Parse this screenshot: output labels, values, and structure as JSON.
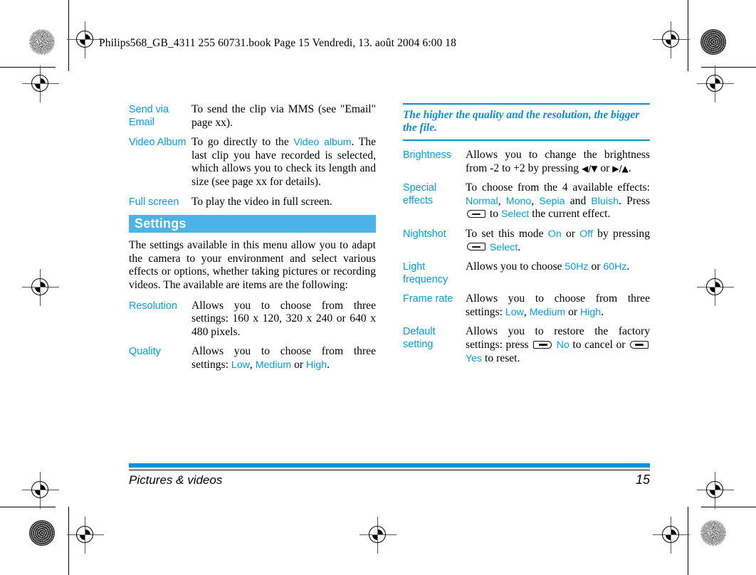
{
  "running_header": "Philips568_GB_4311 255 60731.book  Page 15  Vendredi, 13. août 2004  6:00 18",
  "left_column": {
    "rows_top": [
      {
        "term": "Send via Email",
        "parts": [
          {
            "t": "To send the clip via MMS (see \"Email\" page xx).",
            "blue": false
          }
        ]
      },
      {
        "term": "Video Album",
        "parts": [
          {
            "t": "To go directly to the ",
            "blue": false
          },
          {
            "t": "Video album",
            "blue": true
          },
          {
            "t": ". The last clip you have recorded is selected, which allows you to check its length and size (see page xx for details).",
            "blue": false
          }
        ]
      },
      {
        "term": "Full screen",
        "parts": [
          {
            "t": "To play the video in full screen.",
            "blue": false
          }
        ]
      }
    ],
    "section_title": "Settings",
    "intro_paragraph": "The settings available in this menu allow you to adapt the camera to your environment and select various effects or options, whether taking pictures or recording videos. The available are items are the following:",
    "rows_bottom": [
      {
        "term": "Resolution",
        "parts": [
          {
            "t": "Allows you to choose from three settings:   160 x 120,   320 x 240   or 640 x 480 pixels.",
            "blue": false
          }
        ]
      },
      {
        "term": "Quality",
        "parts": [
          {
            "t": "Allows you to choose from three settings: ",
            "blue": false
          },
          {
            "t": "Low",
            "blue": true
          },
          {
            "t": ", ",
            "blue": false
          },
          {
            "t": "Medium",
            "blue": true
          },
          {
            "t": " or ",
            "blue": false
          },
          {
            "t": "High",
            "blue": true
          },
          {
            "t": ".",
            "blue": false
          }
        ]
      }
    ]
  },
  "right_column": {
    "note": "The higher the quality and the resolution, the bigger the file.",
    "rows": [
      {
        "term": "Brightness",
        "parts": [
          {
            "t": "Allows you to change the brightness from -2 to +2 by pressing ",
            "blue": false
          },
          {
            "t": "◀/▼",
            "blue": false,
            "arrows": true
          },
          {
            "t": " or ",
            "blue": false
          },
          {
            "t": "▶/▲",
            "blue": false,
            "arrows": true
          },
          {
            "t": ".",
            "blue": false
          }
        ]
      },
      {
        "term": "Special effects",
        "parts": [
          {
            "t": "To choose from the 4 available effects: ",
            "blue": false
          },
          {
            "t": "Normal",
            "blue": true
          },
          {
            "t": ", ",
            "blue": false
          },
          {
            "t": "Mono",
            "blue": true
          },
          {
            "t": ", ",
            "blue": false
          },
          {
            "t": "Sepia",
            "blue": true
          },
          {
            "t": " and ",
            "blue": false
          },
          {
            "t": "Bluish",
            "blue": true
          },
          {
            "t": ". Press ",
            "blue": false
          },
          {
            "softkey": "left"
          },
          {
            "t": " to ",
            "blue": false
          },
          {
            "t": "Select",
            "blue": true
          },
          {
            "t": " the current effect.",
            "blue": false
          }
        ]
      },
      {
        "term": "Nightshot",
        "parts": [
          {
            "t": "To set this mode ",
            "blue": false
          },
          {
            "t": "On",
            "blue": true
          },
          {
            "t": " or ",
            "blue": false
          },
          {
            "t": "Off",
            "blue": true
          },
          {
            "t": " by pressing ",
            "blue": false
          },
          {
            "softkey": "left"
          },
          {
            "t": " ",
            "blue": false
          },
          {
            "t": "Select",
            "blue": true
          },
          {
            "t": ".",
            "blue": false
          }
        ]
      },
      {
        "term": "Light frequency",
        "parts": [
          {
            "t": "Allows you to choose ",
            "blue": false
          },
          {
            "t": "50Hz",
            "blue": true
          },
          {
            "t": " or ",
            "blue": false
          },
          {
            "t": "60Hz",
            "blue": true
          },
          {
            "t": ".",
            "blue": false
          }
        ]
      },
      {
        "term": "Frame rate",
        "parts": [
          {
            "t": "Allows you to choose from three settings: ",
            "blue": false
          },
          {
            "t": "Low",
            "blue": true
          },
          {
            "t": ", ",
            "blue": false
          },
          {
            "t": "Medium",
            "blue": true
          },
          {
            "t": " or ",
            "blue": false
          },
          {
            "t": "High",
            "blue": true
          },
          {
            "t": ".",
            "blue": false
          }
        ]
      },
      {
        "term": "Default setting",
        "parts": [
          {
            "t": "Allows you to restore the factory settings: press ",
            "blue": false
          },
          {
            "softkey": "right"
          },
          {
            "t": " ",
            "blue": false
          },
          {
            "t": "No",
            "blue": true
          },
          {
            "t": " to cancel or ",
            "blue": false
          },
          {
            "softkey": "left"
          },
          {
            "t": " ",
            "blue": false
          },
          {
            "t": "Yes",
            "blue": true
          },
          {
            "t": " to reset.",
            "blue": false
          }
        ]
      }
    ]
  },
  "footer": {
    "chapter": "Pictures & videos",
    "page_number": "15"
  },
  "colors": {
    "accent_blue": "#009ee3",
    "section_bar": "#4cb3e8",
    "footer_bar": "#0094e0",
    "note_rule": "#0a8ed6"
  }
}
